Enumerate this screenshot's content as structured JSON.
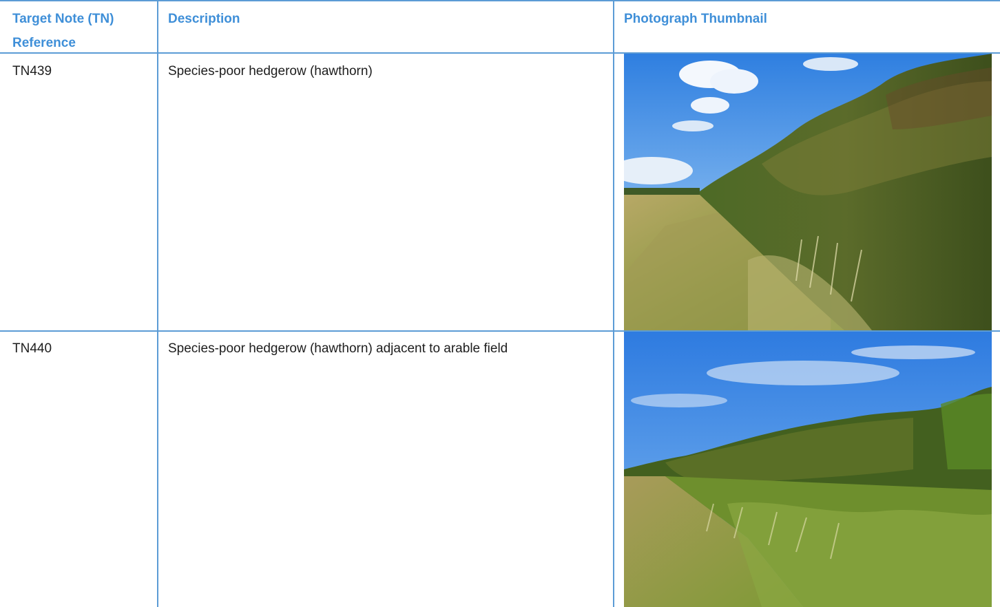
{
  "table": {
    "headers": {
      "reference": "Target Note (TN) Reference",
      "description": "Description",
      "photo": "Photograph Thumbnail"
    },
    "rows": [
      {
        "ref": "TN439",
        "description": "Species-poor hedgerow (hawthorn)",
        "photo_icon": "hedgerow-photo"
      },
      {
        "ref": "TN440",
        "description": "Species-poor hedgerow (hawthorn) adjacent to arable field",
        "photo_icon": "hedgerow-field-photo"
      }
    ]
  },
  "colors": {
    "rule": "#5b9bd5",
    "header_text": "#3f8fd8",
    "body_text": "#1d1d1d"
  }
}
